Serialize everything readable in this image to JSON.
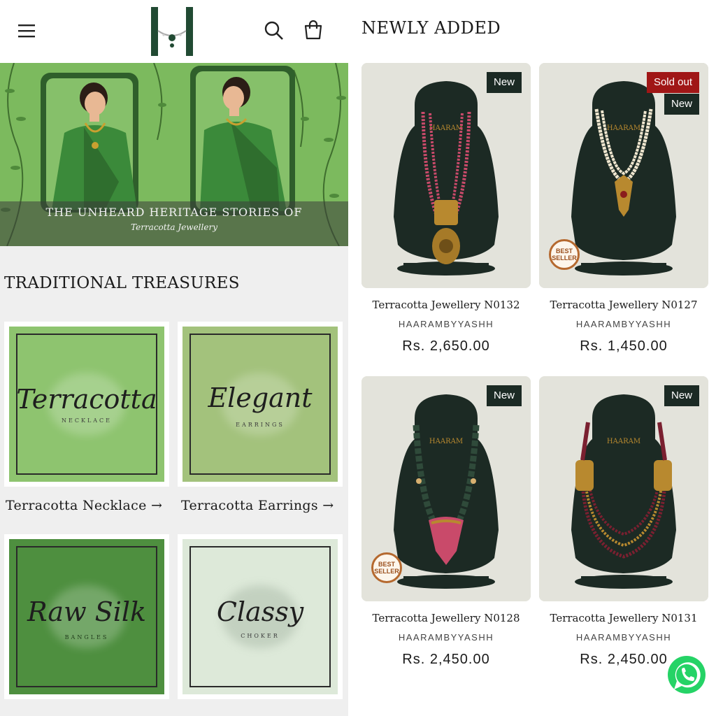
{
  "header": {
    "menu_icon": "hamburger-menu-icon",
    "logo_letter": "H",
    "search_icon": "search-icon",
    "cart_icon": "cart-icon"
  },
  "banner": {
    "line1": "THE UNHEARD HERITAGE STORIES OF",
    "line2": "Terracotta Jewellery"
  },
  "traditional": {
    "title": "TRADITIONAL TREASURES",
    "categories": [
      {
        "script": "Terracotta",
        "sub": "NECKLACE",
        "link": "Terracotta Necklace →",
        "color": "#8ec46f"
      },
      {
        "script": "Elegant",
        "sub": "EARRINGS",
        "link": "Terracotta Earrings →",
        "color": "#a3c27c"
      },
      {
        "script": "Raw Silk",
        "sub": "BANGLES",
        "color": "#4e8f3f"
      },
      {
        "script": "Classy",
        "sub": "CHOKER",
        "color": "#dde9d9"
      }
    ]
  },
  "newly_added": {
    "title": "NEWLY ADDED",
    "products": [
      {
        "name": "Terracotta Jewellery N0132",
        "vendor": "HAARAMBYYASHH",
        "price": "Rs. 2,650.00",
        "badges": [
          "New"
        ],
        "best_seller": false,
        "bead_color": "#c94a6a"
      },
      {
        "name": "Terracotta Jewellery N0127",
        "vendor": "HAARAMBYYASHH",
        "price": "Rs. 1,450.00",
        "badges": [
          "Sold out",
          "New"
        ],
        "best_seller": true,
        "bead_color": "#efe6cf"
      },
      {
        "name": "Terracotta Jewellery N0128",
        "vendor": "HAARAMBYYASHH",
        "price": "Rs. 2,450.00",
        "badges": [
          "New"
        ],
        "best_seller": true,
        "bead_color": "#2f4a3a"
      },
      {
        "name": "Terracotta Jewellery N0131",
        "vendor": "HAARAMBYYASHH",
        "price": "Rs. 2,450.00",
        "badges": [
          "New"
        ],
        "best_seller": false,
        "bead_color": "#7a2030"
      }
    ],
    "best_seller_label": [
      "BEST",
      "SELLER"
    ],
    "bust_brand": "HAARAM"
  },
  "floating": {
    "whatsapp_icon": "whatsapp-icon"
  },
  "colors": {
    "banner_green": "#7cba5e",
    "badge_dark": "#1b2a24",
    "badge_sold": "#a01616",
    "bust": "#1c2a24",
    "gold": "#b8892f",
    "whatsapp": "#25d366"
  }
}
